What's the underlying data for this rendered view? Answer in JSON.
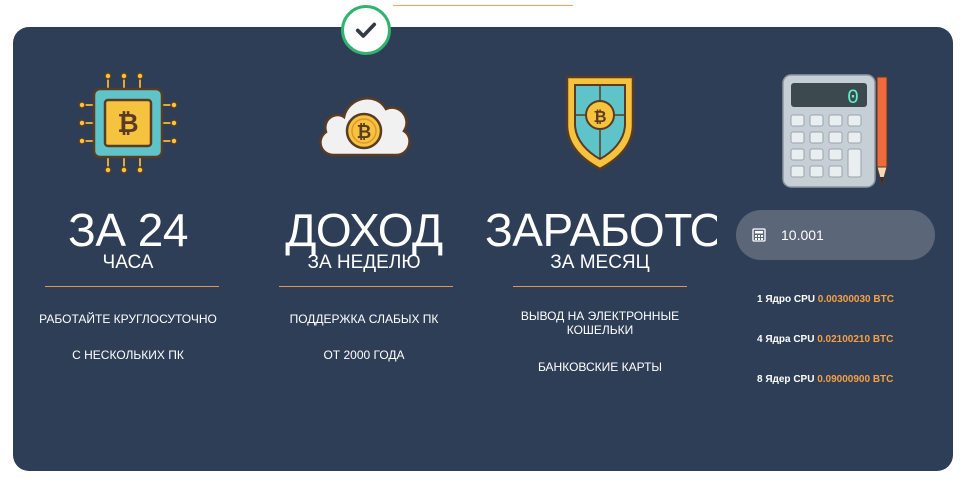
{
  "colors": {
    "panel": "#2e3e56",
    "accent": "#f5a046",
    "check": "#2fb36f",
    "input": "#5b6678"
  },
  "columns": [
    {
      "big": "ЗА 24",
      "sub": "ЧАСА",
      "features": [
        "РАБОТАЙТЕ КРУГЛОСУТОЧНО",
        "С НЕСКОЛЬКИХ ПК"
      ],
      "icon": "bitcoin-chip-icon"
    },
    {
      "big": "ДОХОД",
      "sub": "ЗА НЕДЕЛЮ",
      "features": [
        "ПОДДЕРЖКА СЛАБЫХ ПК",
        "ОТ 2000 ГОДА"
      ],
      "icon": "bitcoin-cloud-icon"
    },
    {
      "big": "ЗАРАБОТОК",
      "sub": "ЗА МЕСЯЦ",
      "features": [
        "ВЫВОД НА ЭЛЕКТРОННЫЕ КОШЕЛЬКИ",
        "БАНКОВСКИЕ КАРТЫ"
      ],
      "icon": "bitcoin-shield-icon"
    }
  ],
  "calculator": {
    "display": "0",
    "input_value": "10.001",
    "rows": [
      {
        "label": "1 Ядро CPU",
        "value": "0.00300030 BTC"
      },
      {
        "label": "4 Ядра CPU",
        "value": "0.02100210 BTC"
      },
      {
        "label": "8 Ядер CPU",
        "value": "0.09000900 BTC"
      }
    ]
  }
}
